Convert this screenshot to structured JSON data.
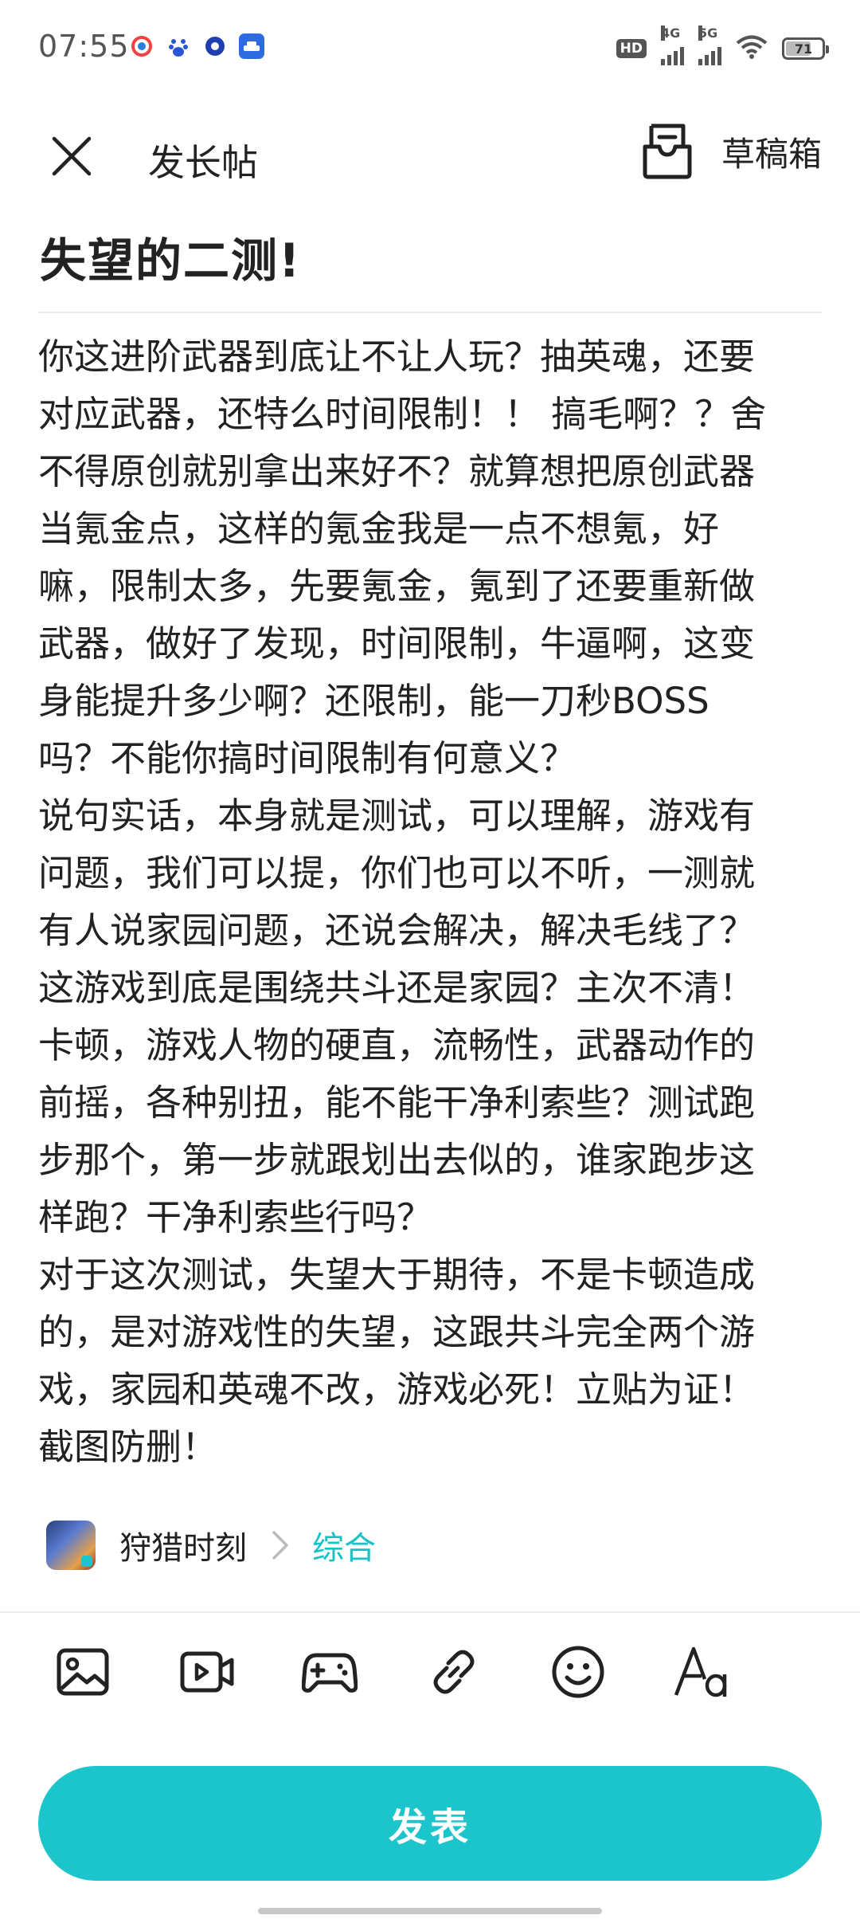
{
  "status_bar": {
    "time": "07:55",
    "network_4g": "4G",
    "network_5g": "5G",
    "hd_badge": "HD",
    "battery": "71",
    "battery_level": 0.71
  },
  "header": {
    "title": "发长帖",
    "draft_label": "草稿箱"
  },
  "post": {
    "title": "失望的二测!",
    "body_lines": [
      "你这进阶武器到底让不让人玩？抽英魂，还要",
      "对应武器，还特么时间限制！！ 搞毛啊？？舍",
      "不得原创就别拿出来好不？就算想把原创武器",
      "当氪金点，这样的氪金我是一点不想氪，好",
      "嘛，限制太多，先要氪金，氪到了还要重新做",
      "武器，做好了发现，时间限制，牛逼啊，这变",
      "身能提升多少啊？还限制，能一刀秒BOSS",
      "吗？不能你搞时间限制有何意义？",
      "说句实话，本身就是测试，可以理解，游戏有",
      "问题，我们可以提，你们也可以不听，一测就",
      "有人说家园问题，还说会解决，解决毛线了？",
      "这游戏到底是围绕共斗还是家园？主次不清！",
      "卡顿，游戏人物的硬直，流畅性，武器动作的",
      "前摇，各种别扭，能不能干净利索些？测试跑",
      "步那个，第一步就跟划出去似的，谁家跑步这",
      "样跑？干净利索些行吗？",
      "对于这次测试，失望大于期待，不是卡顿造成",
      "的，是对游戏性的失望，这跟共斗完全两个游",
      "戏，家园和英魂不改，游戏必死！立贴为证！",
      "截图防删！"
    ]
  },
  "tag": {
    "game_name": "狩猎时刻",
    "category": "综合"
  },
  "toolbar": {
    "items": [
      "image-icon",
      "video-icon",
      "game-controller-icon",
      "link-icon",
      "emoji-icon",
      "text-format-icon"
    ]
  },
  "actions": {
    "publish_label": "发表"
  },
  "colors": {
    "accent": "#1bc5cb",
    "category": "#19c2c6"
  }
}
